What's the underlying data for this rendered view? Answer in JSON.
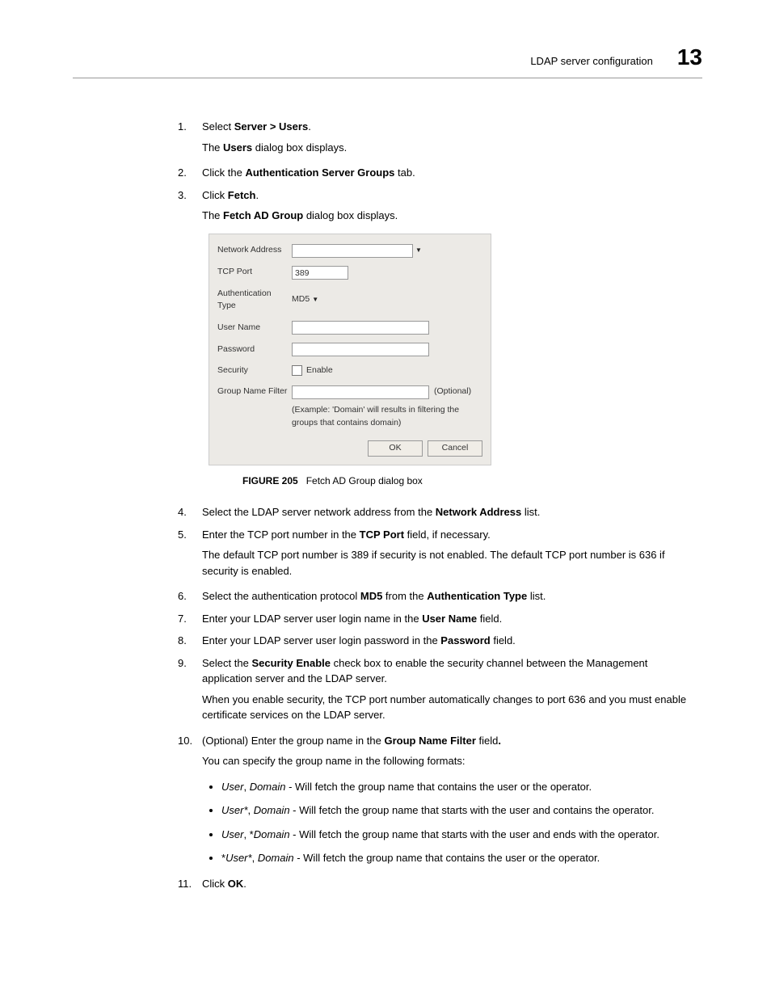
{
  "header": {
    "title": "LDAP server configuration",
    "chapter": "13"
  },
  "steps": {
    "s1_num": "1.",
    "s1_a": "Select ",
    "s1_b": "Server > Users",
    "s1_c": ".",
    "s1_p1a": "The ",
    "s1_p1b": "Users",
    "s1_p1c": " dialog box displays.",
    "s2_num": "2.",
    "s2_a": "Click the ",
    "s2_b": "Authentication Server Groups",
    "s2_c": " tab.",
    "s3_num": "3.",
    "s3_a": "Click ",
    "s3_b": "Fetch",
    "s3_c": ".",
    "s3_p1a": "The ",
    "s3_p1b": "Fetch AD Group",
    "s3_p1c": " dialog box displays.",
    "s4_num": "4.",
    "s4_a": "Select the LDAP server network address from the ",
    "s4_b": "Network Address",
    "s4_c": " list.",
    "s5_num": "5.",
    "s5_a": "Enter the TCP port number in the ",
    "s5_b": "TCP Port",
    "s5_c": " field, if necessary.",
    "s5_p1": "The default TCP port number is 389 if security is not enabled. The default TCP port number is 636 if security is enabled.",
    "s6_num": "6.",
    "s6_a": "Select the authentication protocol ",
    "s6_b": "MD5",
    "s6_c": " from the ",
    "s6_d": "Authentication Type",
    "s6_e": " list.",
    "s7_num": "7.",
    "s7_a": "Enter your LDAP server user login name in the ",
    "s7_b": "User Name",
    "s7_c": " field.",
    "s8_num": "8.",
    "s8_a": "Enter your LDAP server user login password in the ",
    "s8_b": "Password",
    "s8_c": " field.",
    "s9_num": "9.",
    "s9_a": "Select the ",
    "s9_b": "Security Enable",
    "s9_c": " check box to enable the security channel between the Management application server and the LDAP server.",
    "s9_p1": "When you enable security, the TCP port number automatically changes to port 636 and you must enable certificate services on the LDAP server.",
    "s10_num": "10.",
    "s10_a": "(Optional) Enter the group name in the ",
    "s10_b": "Group Name Filter",
    "s10_c": " field",
    "s10_d": ".",
    "s10_p1": "You can specify the group name in the following formats:",
    "b1_a": "User",
    "b1_b": ", ",
    "b1_c": "Domain",
    "b1_d": " - Will fetch the group name that contains the user or the operator.",
    "b2_a": "User*",
    "b2_b": ", ",
    "b2_c": "Domain",
    "b2_d": " - Will fetch the group name that starts with the user and contains the operator.",
    "b3_a": "User",
    "b3_b": ", *",
    "b3_c": "Domain",
    "b3_d": " - Will fetch the group name that starts with the user and ends with the operator.",
    "b4_a": "*",
    "b4_b": "User*",
    "b4_c": ", ",
    "b4_d": "Domain",
    "b4_e": " - Will fetch the group name that contains the user or the operator.",
    "s11_num": "11.",
    "s11_a": "Click ",
    "s11_b": "OK",
    "s11_c": "."
  },
  "dialog": {
    "network_address": "Network Address",
    "tcp_port": "TCP Port",
    "tcp_port_value": "389",
    "auth_type": "Authentication Type",
    "auth_type_value": "MD5",
    "user_name": "User Name",
    "password": "Password",
    "security": "Security",
    "enable": "Enable",
    "group_filter": "Group Name Filter",
    "optional": "(Optional)",
    "hint": "(Example: 'Domain' will results in filtering the groups that contains domain)",
    "ok": "OK",
    "cancel": "Cancel"
  },
  "caption": {
    "label": "FIGURE 205",
    "text": "Fetch AD Group dialog box"
  }
}
